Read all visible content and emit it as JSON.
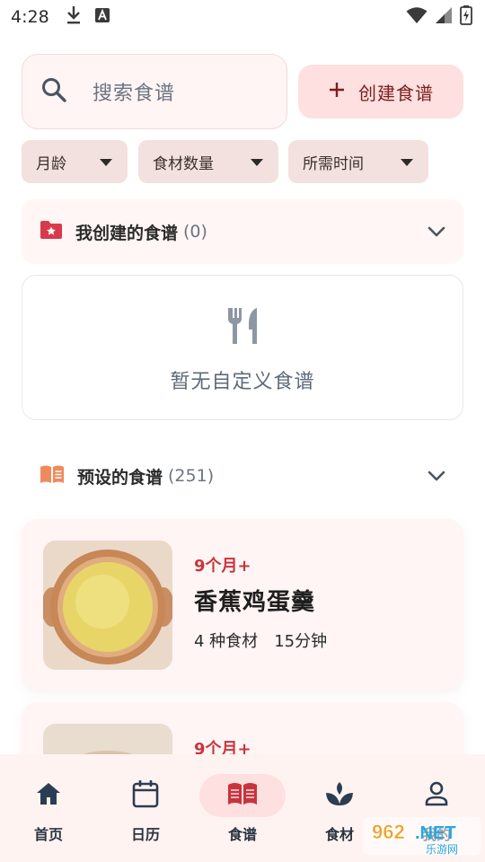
{
  "status_bar": {
    "time": "4:28"
  },
  "search": {
    "placeholder": "搜索食谱"
  },
  "create_button": {
    "label": "创建食谱"
  },
  "filters": [
    {
      "label": "月龄"
    },
    {
      "label": "食材数量"
    },
    {
      "label": "所需时间"
    }
  ],
  "my_recipes": {
    "title": "我创建的食谱",
    "count": "(0)",
    "empty_text": "暂无自定义食谱"
  },
  "preset_recipes": {
    "title": "预设的食谱",
    "count": "(251)",
    "items": [
      {
        "age": "9个月+",
        "name": "香蕉鸡蛋羹",
        "ingredients": "4 种食材",
        "time": "15分钟"
      },
      {
        "age": "9个月+"
      }
    ]
  },
  "bottom_nav": [
    {
      "label": "首页",
      "icon": "home-icon"
    },
    {
      "label": "日历",
      "icon": "calendar-icon"
    },
    {
      "label": "食谱",
      "icon": "recipe-book-icon",
      "active": true
    },
    {
      "label": "食材",
      "icon": "sprout-icon"
    },
    {
      "label": "我的",
      "icon": "person-icon"
    }
  ],
  "watermark": {
    "text_top": "962.NET",
    "text_bottom": "乐游网"
  },
  "colors": {
    "accent": "#c8343d",
    "active_nav_bg": "#fde0df",
    "card_bg": "#fff5f4",
    "chip_bg": "#f3e1df"
  }
}
